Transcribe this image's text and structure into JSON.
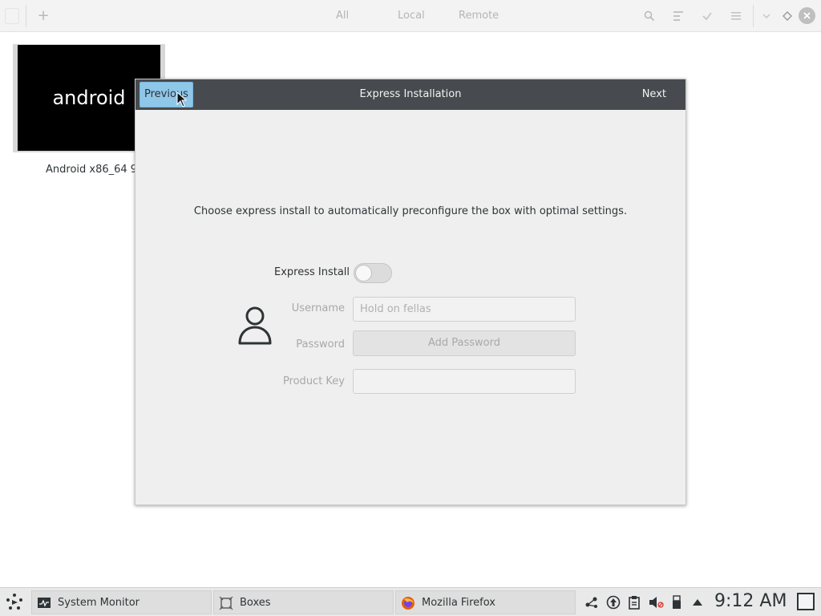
{
  "header": {
    "add_label": "+",
    "tabs": [
      "All",
      "Local",
      "Remote"
    ],
    "icons": [
      "search-icon",
      "selection-mode-icon",
      "check-icon",
      "list-view-icon",
      "chevron-down-icon",
      "diamond-icon",
      "close-icon"
    ]
  },
  "boxes": [
    {
      "logo_text": "android",
      "label": "Android x86_64 9"
    }
  ],
  "dialog": {
    "title": "Express Installation",
    "previous_label": "Previous",
    "next_label": "Next",
    "intro": "Choose express install to automatically preconfigure the box with optimal settings.",
    "express_install_label": "Express Install",
    "express_install_enabled": false,
    "username_label": "Username",
    "username_value": "Hold on fellas",
    "password_label": "Password",
    "add_password_label": "Add Password",
    "product_key_label": "Product Key",
    "product_key_value": ""
  },
  "taskbar": {
    "tasks": [
      {
        "label": "System Monitor",
        "icon": "system-monitor-icon"
      },
      {
        "label": "Boxes",
        "icon": "boxes-icon"
      },
      {
        "label": "Mozilla Firefox",
        "icon": "firefox-icon"
      }
    ],
    "tray_icons": [
      "network-icon",
      "update-icon",
      "clipboard-icon",
      "volume-muted-icon",
      "usb-icon",
      "tray-expand-icon"
    ],
    "clock": "9:12 AM"
  },
  "colors": {
    "dialog_titlebar": "#474b4f",
    "previous_button": "#8fc7e9",
    "tile_background": "#000000"
  }
}
